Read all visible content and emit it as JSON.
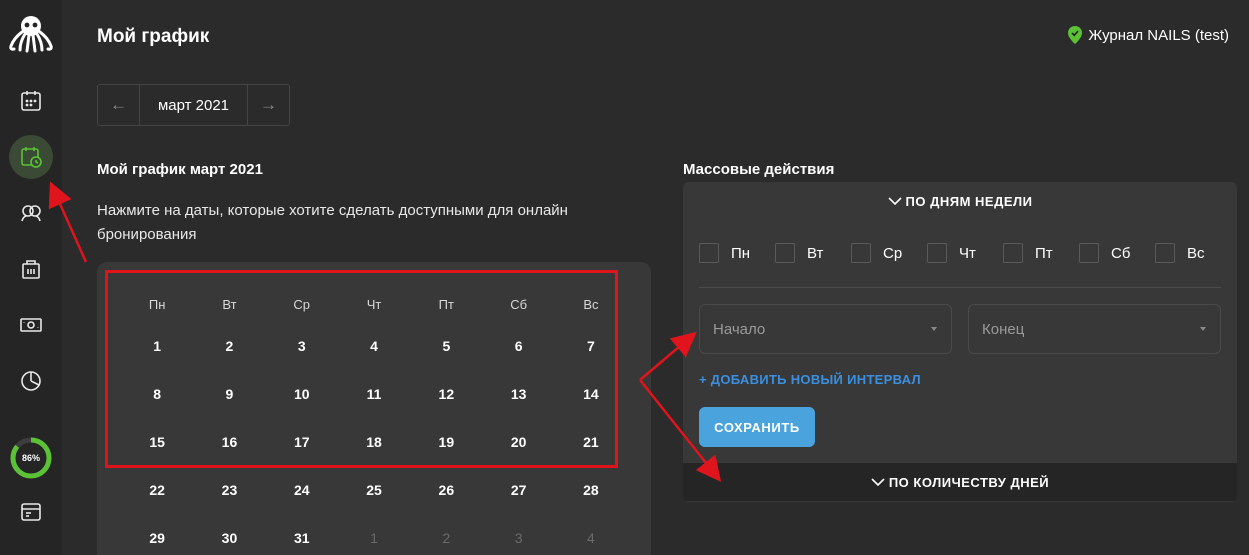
{
  "header": {
    "title": "Мой график",
    "journal_label": "Журнал NAILS (test)"
  },
  "sidebar": {
    "items": [
      {
        "icon": "calendar-icon"
      },
      {
        "icon": "schedule-icon",
        "active": true
      },
      {
        "icon": "clients-icon"
      },
      {
        "icon": "building-icon"
      },
      {
        "icon": "money-icon"
      },
      {
        "icon": "pie-chart-icon"
      },
      {
        "icon": "window-icon"
      }
    ],
    "progress": {
      "value": 86,
      "label": "86%"
    }
  },
  "month_nav": {
    "prev_icon": "←",
    "month": "март 2021",
    "next_icon": "→"
  },
  "schedule": {
    "title": "Мой график март 2021",
    "instruction": "Нажмите на даты, которые хотите сделать доступными для онлайн бронирования",
    "weekdays": [
      "Пн",
      "Вт",
      "Ср",
      "Чт",
      "Пт",
      "Сб",
      "Вс"
    ],
    "weeks": [
      [
        "1",
        "2",
        "3",
        "4",
        "5",
        "6",
        "7"
      ],
      [
        "8",
        "9",
        "10",
        "11",
        "12",
        "13",
        "14"
      ],
      [
        "15",
        "16",
        "17",
        "18",
        "19",
        "20",
        "21"
      ],
      [
        "22",
        "23",
        "24",
        "25",
        "26",
        "27",
        "28"
      ],
      [
        "29",
        "30",
        "31",
        "1",
        "2",
        "3",
        "4"
      ]
    ],
    "muted_last_row_from": 3
  },
  "mass_actions": {
    "title": "Массовые действия",
    "by_weekdays": "ПО ДНЯМ НЕДЕЛИ",
    "weekdays": [
      "Пн",
      "Вт",
      "Ср",
      "Чт",
      "Пт",
      "Сб",
      "Вс"
    ],
    "start_placeholder": "Начало",
    "end_placeholder": "Конец",
    "add_interval": "+ ДОБАВИТЬ НОВЫЙ ИНТЕРВАЛ",
    "save_label": "СОХРАНИТЬ",
    "by_day_count": "ПО КОЛИЧЕСТВУ ДНЕЙ"
  },
  "colors": {
    "accent_green": "#5bc236",
    "accent_blue": "#4aa3dd",
    "highlight_red": "#e0141c"
  }
}
